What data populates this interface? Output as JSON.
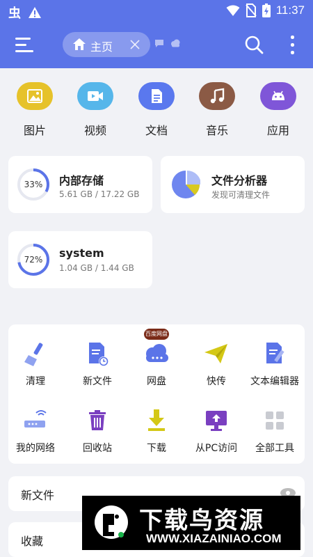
{
  "status_bar": {
    "time": "11:37",
    "app_glyph": "虫"
  },
  "app_bar": {
    "tab_label": "主页"
  },
  "categories": [
    {
      "label": "图片",
      "icon": "image-icon",
      "color": "#e6c22a"
    },
    {
      "label": "视频",
      "icon": "video-icon",
      "color": "#56b6ea"
    },
    {
      "label": "文档",
      "icon": "document-icon",
      "color": "#5a78ee"
    },
    {
      "label": "音乐",
      "icon": "music-icon",
      "color": "#8b5a45"
    },
    {
      "label": "应用",
      "icon": "android-icon",
      "color": "#7f56d8"
    }
  ],
  "storage": {
    "internal": {
      "title": "内部存储",
      "usage": "5.61 GB / 17.22 GB",
      "percent_label": "33%",
      "percent": 33
    },
    "analyzer": {
      "title": "文件分析器",
      "subtitle": "发现可清理文件"
    },
    "system": {
      "title": "system",
      "usage": "1.04 GB / 1.44 GB",
      "percent_label": "72%",
      "percent": 72
    }
  },
  "tools": {
    "badge": "百度网盘",
    "items": [
      {
        "label": "清理",
        "icon": "broom-icon"
      },
      {
        "label": "新文件",
        "icon": "new-file-icon"
      },
      {
        "label": "网盘",
        "icon": "cloud-drive-icon"
      },
      {
        "label": "快传",
        "icon": "paper-plane-icon"
      },
      {
        "label": "文本编辑器",
        "icon": "text-editor-icon"
      },
      {
        "label": "我的网络",
        "icon": "router-icon"
      },
      {
        "label": "回收站",
        "icon": "trash-icon"
      },
      {
        "label": "下载",
        "icon": "download-icon"
      },
      {
        "label": "从PC访问",
        "icon": "pc-access-icon"
      },
      {
        "label": "全部工具",
        "icon": "grid-icon"
      }
    ]
  },
  "sections": {
    "new_files": "新文件",
    "favorites": "收藏"
  },
  "watermark": {
    "brand": "下载鸟资源",
    "url": "WWW.XIAZAINIAO.COM"
  },
  "colors": {
    "primary": "#5b74e8",
    "accent_ring": "#5b74e8"
  }
}
